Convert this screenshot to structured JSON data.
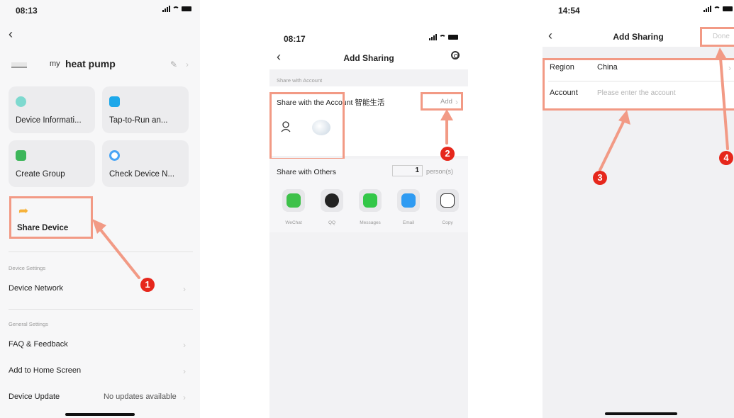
{
  "phone1": {
    "status_time": "08:13",
    "device_prefix": "my",
    "device_name": "heat pump",
    "cards": [
      {
        "label": "Device Informati...",
        "icon": "info-icon"
      },
      {
        "label": "Tap-to-Run an...",
        "icon": "shield-check-icon"
      },
      {
        "label": "Create Group",
        "icon": "group-add-icon"
      },
      {
        "label": "Check Device N...",
        "icon": "network-check-icon"
      }
    ],
    "share_device_label": "Share Device",
    "section_device_settings": "Device Settings",
    "device_network": "Device Network",
    "section_general_settings": "General Settings",
    "faq": "FAQ & Feedback",
    "add_home": "Add to Home Screen",
    "device_update": "Device Update",
    "device_update_value": "No updates available",
    "badge": "1"
  },
  "phone2": {
    "status_time": "08:17",
    "title": "Add Sharing",
    "section_share_account": "Share with Account",
    "share_with_account": "Share with the Account 智能生活",
    "add_label": "Add",
    "share_with_others": "Share with Others",
    "person_count": "1",
    "person_unit": "person(s)",
    "share_options": [
      "WeChat",
      "QQ",
      "Messages",
      "Email",
      "Copy"
    ],
    "badge": "2"
  },
  "phone3": {
    "status_time": "14:54",
    "title": "Add Sharing",
    "done": "Done",
    "region_label": "Region",
    "region_value": "China",
    "account_label": "Account",
    "account_placeholder": "Please enter the account",
    "badge3": "3",
    "badge4": "4"
  },
  "colors": {
    "highlight": "#f29a85",
    "badge": "#e6271c",
    "wechat": "#3ec14a",
    "messages": "#33c748",
    "email": "#2f9bf2"
  }
}
